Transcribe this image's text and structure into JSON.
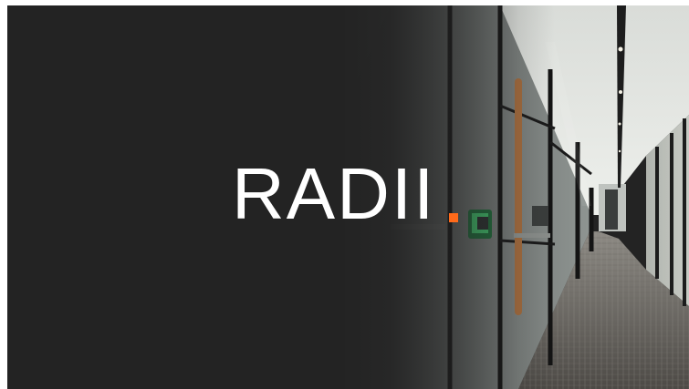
{
  "brand": {
    "name": "RADII",
    "accent_color": "#ff6a1a"
  },
  "hero": {
    "background_color": "#232323",
    "scene": "office-glass-corridor-photo"
  }
}
